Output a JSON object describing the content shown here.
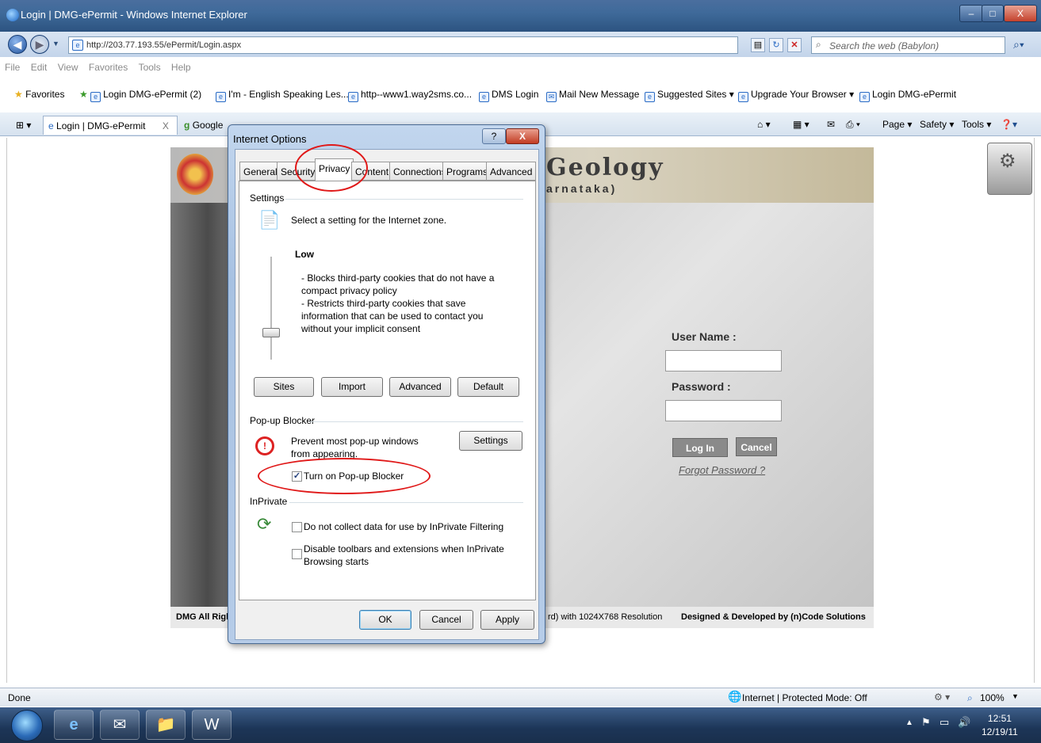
{
  "window": {
    "title": "Login | DMG-ePermit - Windows Internet Explorer",
    "minimize": "–",
    "maximize": "□",
    "close": "X"
  },
  "address": {
    "url": "http://203.77.193.55/ePermit/Login.aspx",
    "search_placeholder": "Search the web (Babylon)"
  },
  "menu": [
    "File",
    "Edit",
    "View",
    "Favorites",
    "Tools",
    "Help"
  ],
  "favorites": {
    "label": "Favorites",
    "items": [
      "Login DMG-ePermit (2)",
      "I'm - English Speaking Les...",
      "http--www1.way2sms.co...",
      "DMS Login",
      "Mail New Message",
      "Suggested Sites ▾",
      "Upgrade Your Browser ▾",
      "Login DMG-ePermit"
    ]
  },
  "tabs": {
    "active": "Login | DMG-ePermit",
    "second": "Google",
    "close_glyph": "X"
  },
  "commandbar": {
    "page": "Page ▾",
    "safety": "Safety ▾",
    "tools": "Tools ▾"
  },
  "site": {
    "heading": "Geology",
    "subheading": "arnataka)",
    "username_label": "User Name :",
    "password_label": "Password :",
    "login_button": "Log In",
    "cancel_button": "Cancel",
    "forgot_link": "Forgot Password ?",
    "footer_left": "DMG All Righ",
    "footer_mid": "rd) with 1024X768 Resolution",
    "footer_right": "Designed & Developed by (n)Code Solutions"
  },
  "dialog": {
    "title": "Internet Options",
    "help": "?",
    "close": "X",
    "tabs": [
      "General",
      "Security",
      "Privacy",
      "Content",
      "Connections",
      "Programs",
      "Advanced"
    ],
    "active_tab": "Privacy",
    "settings_group": "Settings",
    "settings_intro": "Select a setting for the Internet zone.",
    "level": "Low",
    "level_desc_1": "- Blocks third-party cookies that do not have a compact privacy policy",
    "level_desc_2": "- Restricts third-party cookies that save information that can be used to contact you without your implicit consent",
    "buttons_row": [
      "Sites",
      "Import",
      "Advanced",
      "Default"
    ],
    "popup_group": "Pop-up Blocker",
    "popup_text": "Prevent most pop-up windows from appearing.",
    "popup_settings": "Settings",
    "popup_checkbox": "Turn on Pop-up Blocker",
    "popup_checked": true,
    "inprivate_group": "InPrivate",
    "inprivate_cb1": "Do not collect data for use by InPrivate Filtering",
    "inprivate_cb2": "Disable toolbars and extensions when InPrivate Browsing starts",
    "ok": "OK",
    "cancel": "Cancel",
    "apply": "Apply",
    "slider_level": 0.2
  },
  "statusbar": {
    "left": "Done",
    "zone": "Internet | Protected Mode: Off",
    "zoom": "100%"
  },
  "taskbar": {
    "time": "12:51",
    "date": "12/19/11"
  },
  "colors": {
    "highlight_oval": "#e01818",
    "titlebar": "#3f6a9a"
  }
}
